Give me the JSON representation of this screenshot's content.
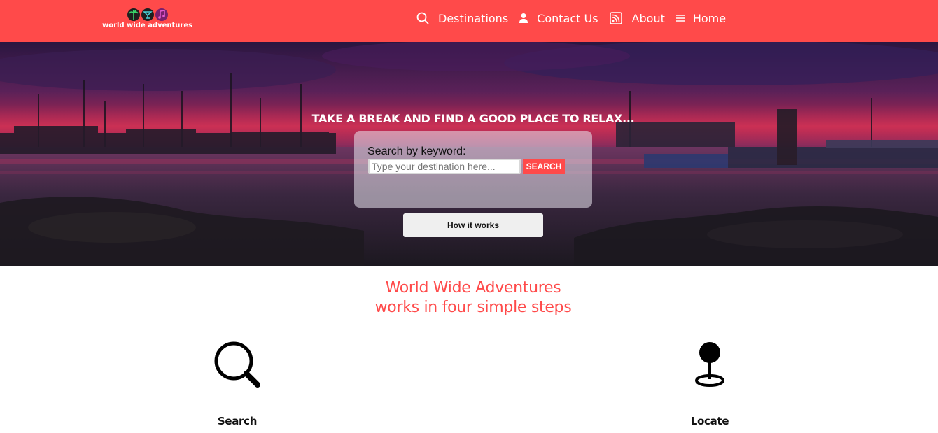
{
  "header": {
    "logo_text": "world wide adventures",
    "logo_icons": [
      "palm-tree-icon",
      "cocktail-icon",
      "music-icon"
    ],
    "nav": [
      {
        "icon": "search-icon",
        "label": "Destinations"
      },
      {
        "icon": "user-icon",
        "label": "Contact Us"
      },
      {
        "icon": "rss-icon",
        "label": "About"
      },
      {
        "icon": "menu-icon",
        "label": "Home"
      }
    ]
  },
  "hero": {
    "tagline": "TAKE A BREAK AND FIND A GOOD PLACE TO RELAX...",
    "search_label": "Search by keyword:",
    "search_placeholder": "Type your destination here...",
    "search_button": "SEARCH",
    "how_button": "How it works"
  },
  "steps": {
    "title_line1": "World Wide Adventures",
    "title_line2": "works in four simple steps",
    "items": [
      {
        "icon": "magnifier-icon",
        "label": "Search"
      },
      {
        "icon": "map-pin-icon",
        "label": "Locate"
      }
    ]
  },
  "colors": {
    "brand": "#ff4a4a",
    "white": "#ffffff",
    "button_gray": "#efefef"
  }
}
